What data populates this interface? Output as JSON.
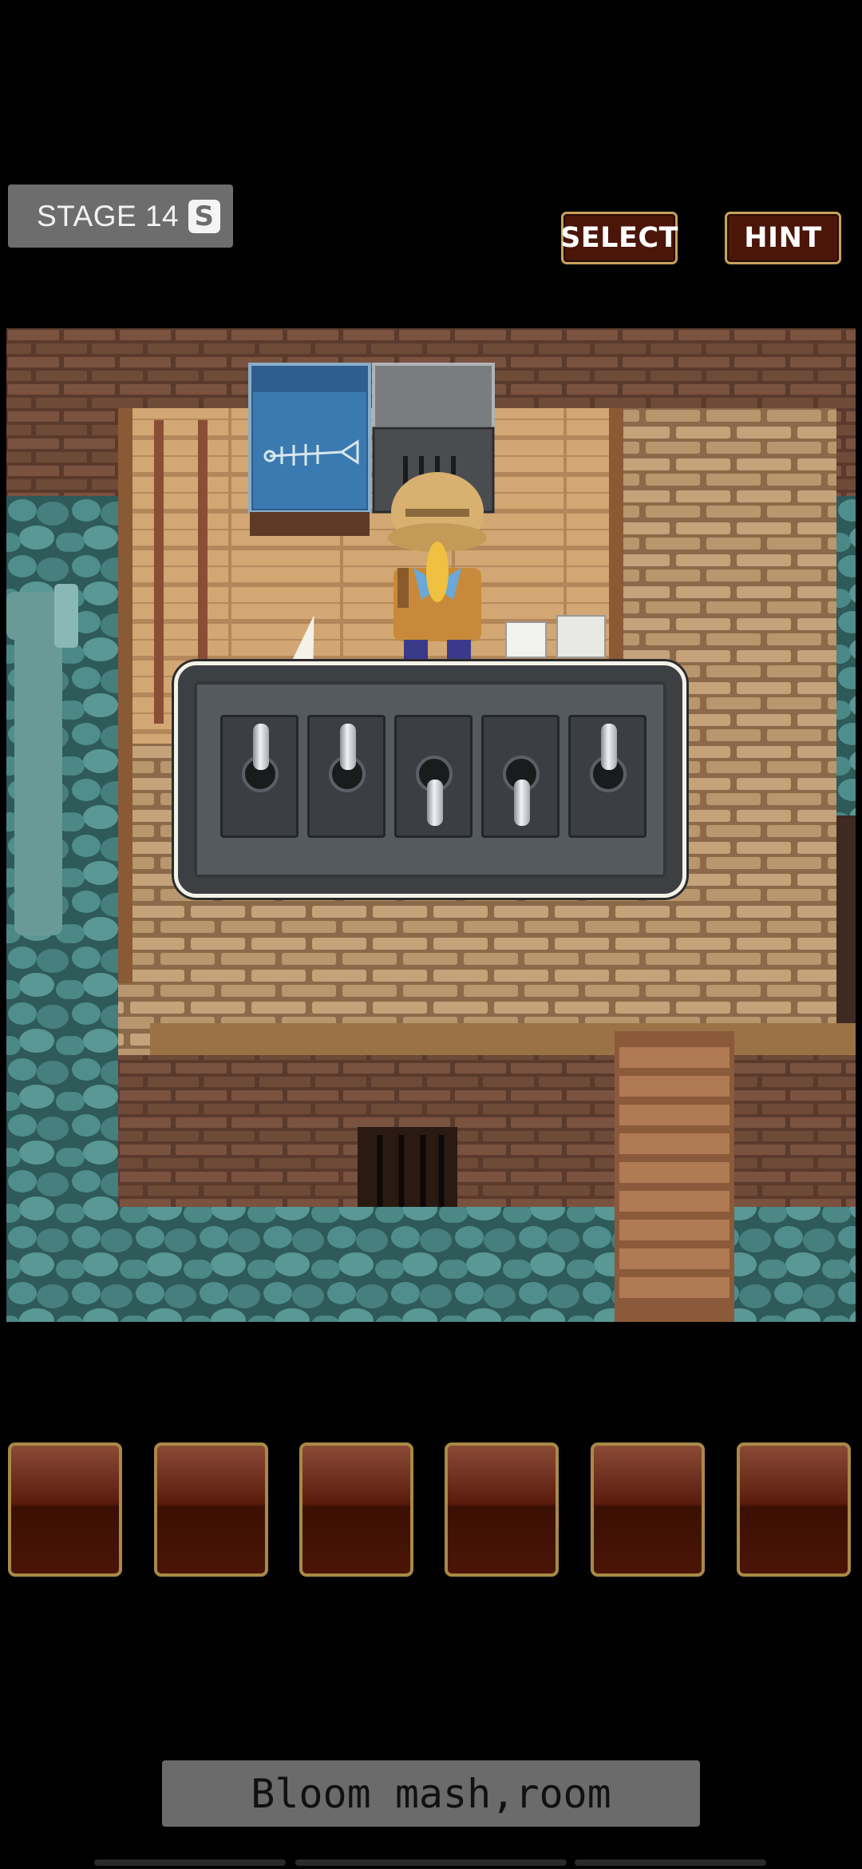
{
  "header": {
    "stage_label": "STAGE 14",
    "stage_icon": "S",
    "select_label": "SELECT",
    "hint_label": "HINT"
  },
  "switches": [
    {
      "state": "up"
    },
    {
      "state": "up"
    },
    {
      "state": "down"
    },
    {
      "state": "down"
    },
    {
      "state": "up"
    }
  ],
  "inventory": {
    "slots": [
      "",
      "",
      "",
      "",
      "",
      ""
    ]
  },
  "message": "Bloom mash,room",
  "colors": {
    "button_bg": "#4b1508",
    "button_border": "#c8a25a",
    "stage_bg": "#6d6d6d",
    "water": "#4a8a8a",
    "brick": "#6b4a38"
  }
}
